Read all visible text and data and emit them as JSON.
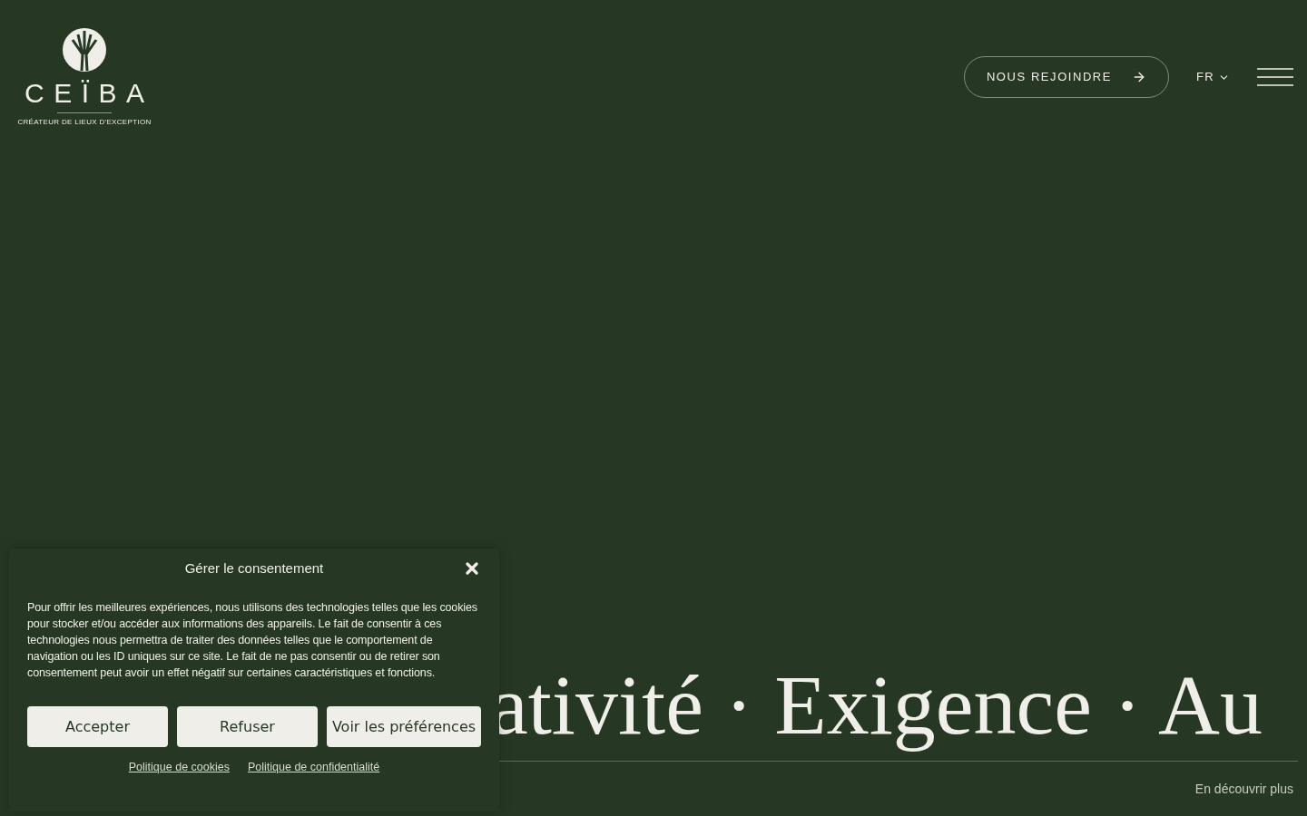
{
  "logo": {
    "name": "CEÏBA",
    "tagline": "CRÉATEUR DE LIEUX D'EXCEPTION"
  },
  "header": {
    "join_button": "NOUS REJOINDRE",
    "language": "FR"
  },
  "hero": {
    "marquee": "ativité · Exigence · Au",
    "more_link": "En découvrir plus"
  },
  "consent": {
    "title": "Gérer le consentement",
    "body": "Pour offrir les meilleures expériences, nous utilisons des technologies telles que les cookies pour stocker et/ou accéder aux informations des appareils. Le fait de consentir à ces technologies nous permettra de traiter des données telles que le comportement de navigation ou les ID uniques sur ce site. Le fait de ne pas consentir ou de retirer son consentement peut avoir un effet négatif sur certaines caractéristiques et fonctions.",
    "buttons": [
      "Accepter",
      "Refuser",
      "Voir les préférences"
    ],
    "links": [
      "Politique de cookies",
      "Politique de confidentialité"
    ]
  }
}
